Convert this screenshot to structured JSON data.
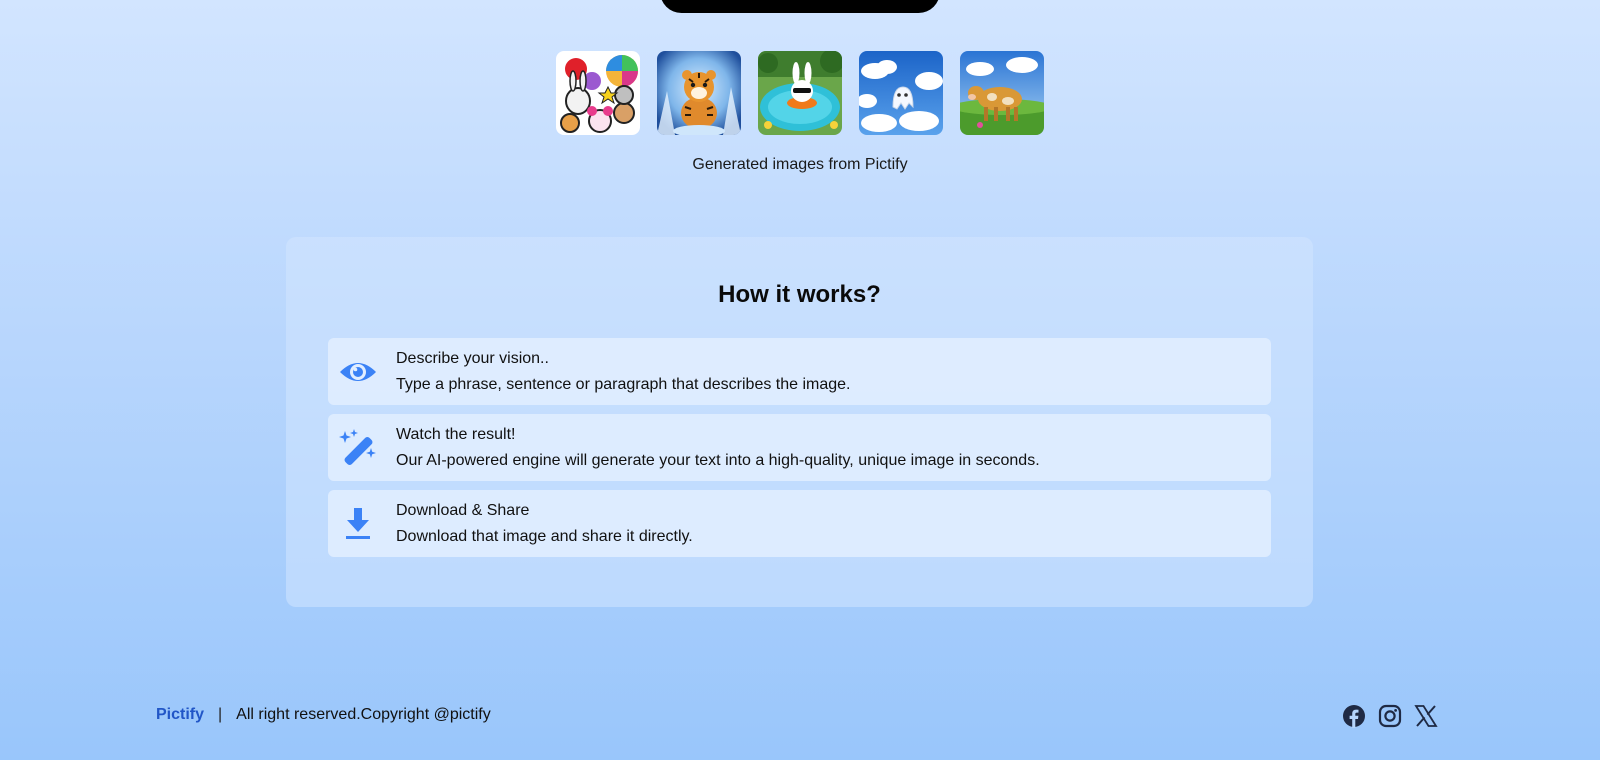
{
  "gallery": {
    "caption": "Generated images from Pictify",
    "images": [
      {
        "name": "cartoon-animals-image"
      },
      {
        "name": "tiger-cub-image"
      },
      {
        "name": "bunny-pool-image"
      },
      {
        "name": "ghost-clouds-image"
      },
      {
        "name": "cow-field-image"
      }
    ]
  },
  "how_it_works": {
    "title": "How it works?",
    "steps": [
      {
        "icon": "eye-icon",
        "title": "Describe your vision..",
        "description": "Type a phrase, sentence or paragraph that describes the image."
      },
      {
        "icon": "magic-wand-icon",
        "title": "Watch the result!",
        "description": "Our AI-powered engine will generate your text into a high-quality, unique image in seconds."
      },
      {
        "icon": "download-icon",
        "title": "Download & Share",
        "description": "Download that image and share it directly."
      }
    ]
  },
  "footer": {
    "brand": "Pictify",
    "separator": "|",
    "copyright": "All right reserved.Copyright @pictify",
    "socials": [
      "facebook-icon",
      "instagram-icon",
      "x-twitter-icon"
    ]
  },
  "colors": {
    "accent": "#3b82f6",
    "brand": "#2156c7"
  }
}
